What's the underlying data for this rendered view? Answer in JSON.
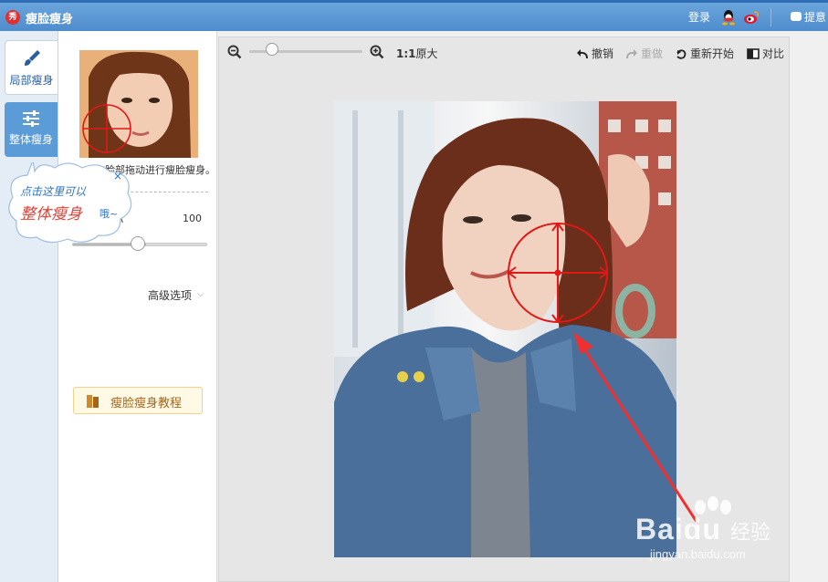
{
  "app": {
    "logo_text": "秀",
    "title": "瘦脸瘦身",
    "login": "登录",
    "feedback": "提意"
  },
  "nav": {
    "local_label": "局部瘦身",
    "whole_label": "整体瘦身"
  },
  "panel": {
    "instruction": "在脸部拖动进行瘦脸瘦身。",
    "size_label": "小",
    "size_value": "100",
    "size_slider_fraction": 0.55,
    "advanced": "高级选项",
    "tutorial": "瘦脸瘦身教程"
  },
  "tip": {
    "line1": "点击这里可以",
    "line2": "整体瘦身",
    "line3": "哦~"
  },
  "toolbar": {
    "actual_bold": "1:1",
    "actual_label": "原大",
    "undo": "撤销",
    "redo": "重做",
    "restart": "重新开始",
    "compare": "对比",
    "zoom_fraction": 0.2
  },
  "watermark": {
    "name": "Baidu",
    "sub": "经验",
    "url": "jingyan.baidu.com"
  },
  "colors": {
    "titlebar": "#5b96d4",
    "accent": "#2a72c6",
    "brush_circle": "#e01818"
  }
}
